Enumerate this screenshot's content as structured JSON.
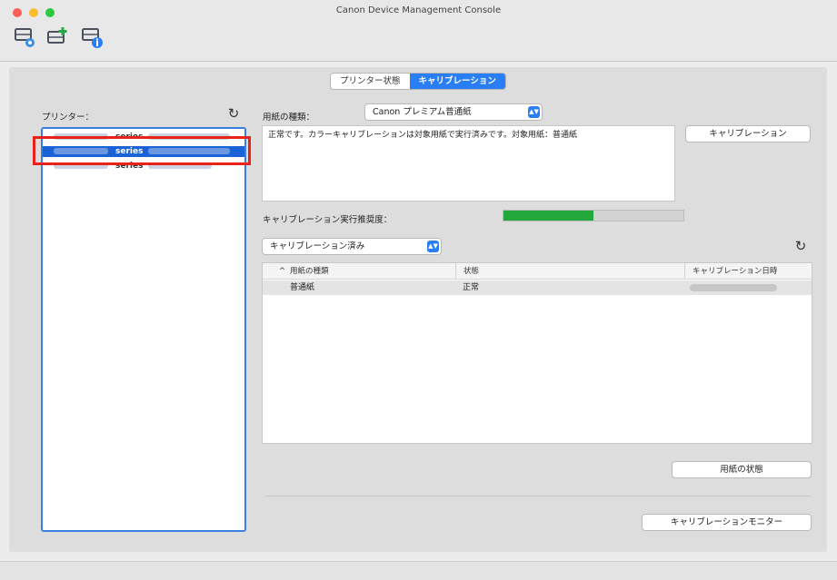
{
  "window": {
    "title": "Canon Device Management Console"
  },
  "toolbar": {
    "icons": [
      "printer-settings-icon",
      "add-printer-icon",
      "printer-info-icon"
    ]
  },
  "tabs": [
    {
      "label": "プリンター状態",
      "active": false
    },
    {
      "label": "キャリブレーション",
      "active": true
    }
  ],
  "sidebar": {
    "label": "プリンター：",
    "printers": [
      {
        "name": "series",
        "selected": false
      },
      {
        "name": "series",
        "selected": true
      },
      {
        "name": "series",
        "selected": false
      }
    ]
  },
  "calibration": {
    "paper_type_label": "用紙の種類：",
    "paper_type_value": "Canon プレミアム普通紙",
    "message": "正常です。カラーキャリブレーションは対象用紙で実行済みです。対象用紙：普通紙",
    "calibrate_button": "キャリブレーション",
    "progress_label": "キャリブレーション実行推奨度：",
    "progress_fraction": 0.5,
    "progress_color": "#23a83b"
  },
  "filter": {
    "value": "キャリブレーション済み"
  },
  "table": {
    "columns": [
      "用紙の種類",
      "状態",
      "キャリブレーション日時"
    ],
    "sort_indicator": "^",
    "rows": [
      {
        "paper": "普通紙",
        "status": "正常"
      }
    ]
  },
  "buttons": {
    "paper_status": "用紙の状態",
    "monitor": "キャリブレーションモニター"
  },
  "colors": {
    "accent": "#2a7ef5",
    "selection": "#1a63d6",
    "highlight_box": "#e8231a"
  }
}
